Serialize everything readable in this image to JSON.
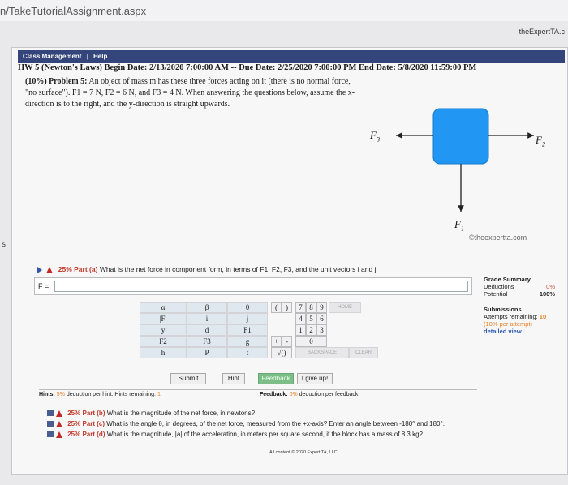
{
  "browser": {
    "url": "n/TakeTutorialAssignment.aspx",
    "brand": "theExpertTA.c"
  },
  "page": {
    "left_marker": "s"
  },
  "class_bar": {
    "class_management": "Class Management",
    "separator": "|",
    "help": "Help"
  },
  "assignment": {
    "line": "HW 5 (Newton's Laws) Begin Date: 2/13/2020 7:00:00 AM -- Due Date: 2/25/2020 7:00:00 PM End Date: 5/8/2020 11:59:00 PM"
  },
  "problem": {
    "head": "(10%) Problem 5:",
    "text": "An object of mass m has these three forces acting on it (there is no normal force, \"no surface\"). F1 = 7 N, F2 = 6 N, and F3 = 4 N. When answering the questions below, assume the x-direction is to the right, and the y-direction is straight upwards."
  },
  "figure": {
    "f3": "F",
    "f3_sub": "3",
    "f2": "F",
    "f2_sub": "2",
    "f1": "F",
    "f1_sub": "1",
    "block_color": "#2196f3",
    "watermark": "©theexpertta.com"
  },
  "part_a": {
    "percent": "25%",
    "label": "Part (a)",
    "question": "What is the net force in component form, in terms of F1, F2, F3, and the unit vectors i and j",
    "answer_label": "F ="
  },
  "keypad": {
    "symbols": [
      [
        "α",
        "β",
        "θ"
      ],
      [
        "|F|",
        "i",
        "j"
      ],
      [
        "y",
        "d",
        "F1"
      ],
      [
        "F2",
        "F3",
        "g"
      ],
      [
        "h",
        "P",
        "t"
      ]
    ],
    "ops_top": [
      "(",
      ")"
    ],
    "ops_mid": [
      "+",
      "-"
    ],
    "sqrt": "√()",
    "digits": [
      [
        "7",
        "8",
        "9"
      ],
      [
        "4",
        "5",
        "6"
      ],
      [
        "1",
        "2",
        "3"
      ],
      [
        "0"
      ]
    ],
    "home": "HOME",
    "backspace": "BACKSPACE",
    "clear": "CLEAR",
    "star": "*"
  },
  "buttons": {
    "submit": "Submit",
    "hint": "Hint",
    "feedback": "Feedback",
    "give_up": "I give up!"
  },
  "hints_bar": {
    "hints_label": "Hints:",
    "hints_pct": "5%",
    "hints_text": "deduction per hint. Hints remaining:",
    "hints_remaining": "1",
    "feedback_label": "Feedback:",
    "feedback_pct": "0%",
    "feedback_text": "deduction per feedback."
  },
  "grade_summary": {
    "title": "Grade Summary",
    "deductions_label": "Deductions",
    "deductions_value": "0%",
    "potential_label": "Potential",
    "potential_value": "100%",
    "submissions_title": "Submissions",
    "attempts_label": "Attempts remaining:",
    "attempts_value": "10",
    "per_attempt": "(10% per attempt)",
    "detailed_view": "detailed view"
  },
  "other_parts": [
    {
      "percent": "25%",
      "label": "Part (b)",
      "question": "What is the magnitude of the net force, in newtons?"
    },
    {
      "percent": "25%",
      "label": "Part (c)",
      "question": "What is the angle θ, in degrees, of the net force, measured from the +x-axis? Enter an angle between -180° and 180°."
    },
    {
      "percent": "25%",
      "label": "Part (d)",
      "question": "What is the magnitude, |a| of the acceleration, in meters per square second, if the block has a mass of 8.3 kg?"
    }
  ],
  "copyright": "All content © 2020 Expert TA, LLC"
}
